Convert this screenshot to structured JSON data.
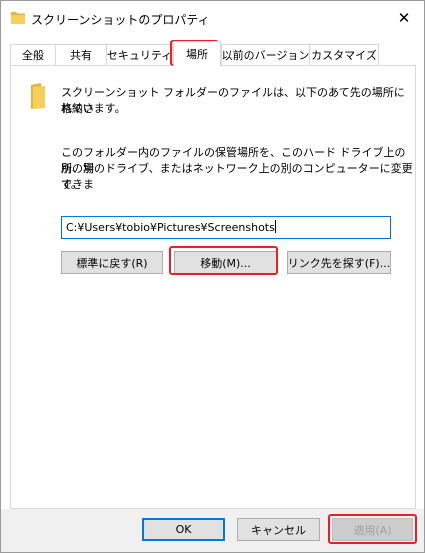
{
  "window": {
    "title": "スクリーンショットのプロパティ",
    "close_symbol": "✕"
  },
  "tabs": [
    {
      "label": "全般"
    },
    {
      "label": "共有"
    },
    {
      "label": "セキュリティ"
    },
    {
      "label": "場所",
      "active": true
    },
    {
      "label": "以前のバージョン"
    },
    {
      "label": "カスタマイズ"
    }
  ],
  "location": {
    "intro_line1": "スクリーンショット フォルダーのファイルは、以下のあて先の場所に格納さ",
    "intro_line2": "れています。",
    "desc_line1": "このフォルダー内のファイルの保管場所を、このハード ドライブ上の別の場",
    "desc_line2": "所、別のドライブ、またはネットワーク上の別のコンピューターに変更できま",
    "desc_line3": "す。",
    "path_value": "C:¥Users¥tobio¥Pictures¥Screenshots",
    "restore_default_label": "標準に戻す(R)",
    "move_label": "移動(M)...",
    "find_target_label": "リンク先を探す(F)..."
  },
  "footer": {
    "ok_label": "OK",
    "cancel_label": "キャンセル",
    "apply_label": "適用(A)"
  },
  "colors": {
    "highlight": "#e8202a",
    "folder": "#f4c24c",
    "focus_border": "#0078d7"
  },
  "icons": {
    "title": "folder-icon",
    "close": "close-icon",
    "location": "folder-icon"
  }
}
